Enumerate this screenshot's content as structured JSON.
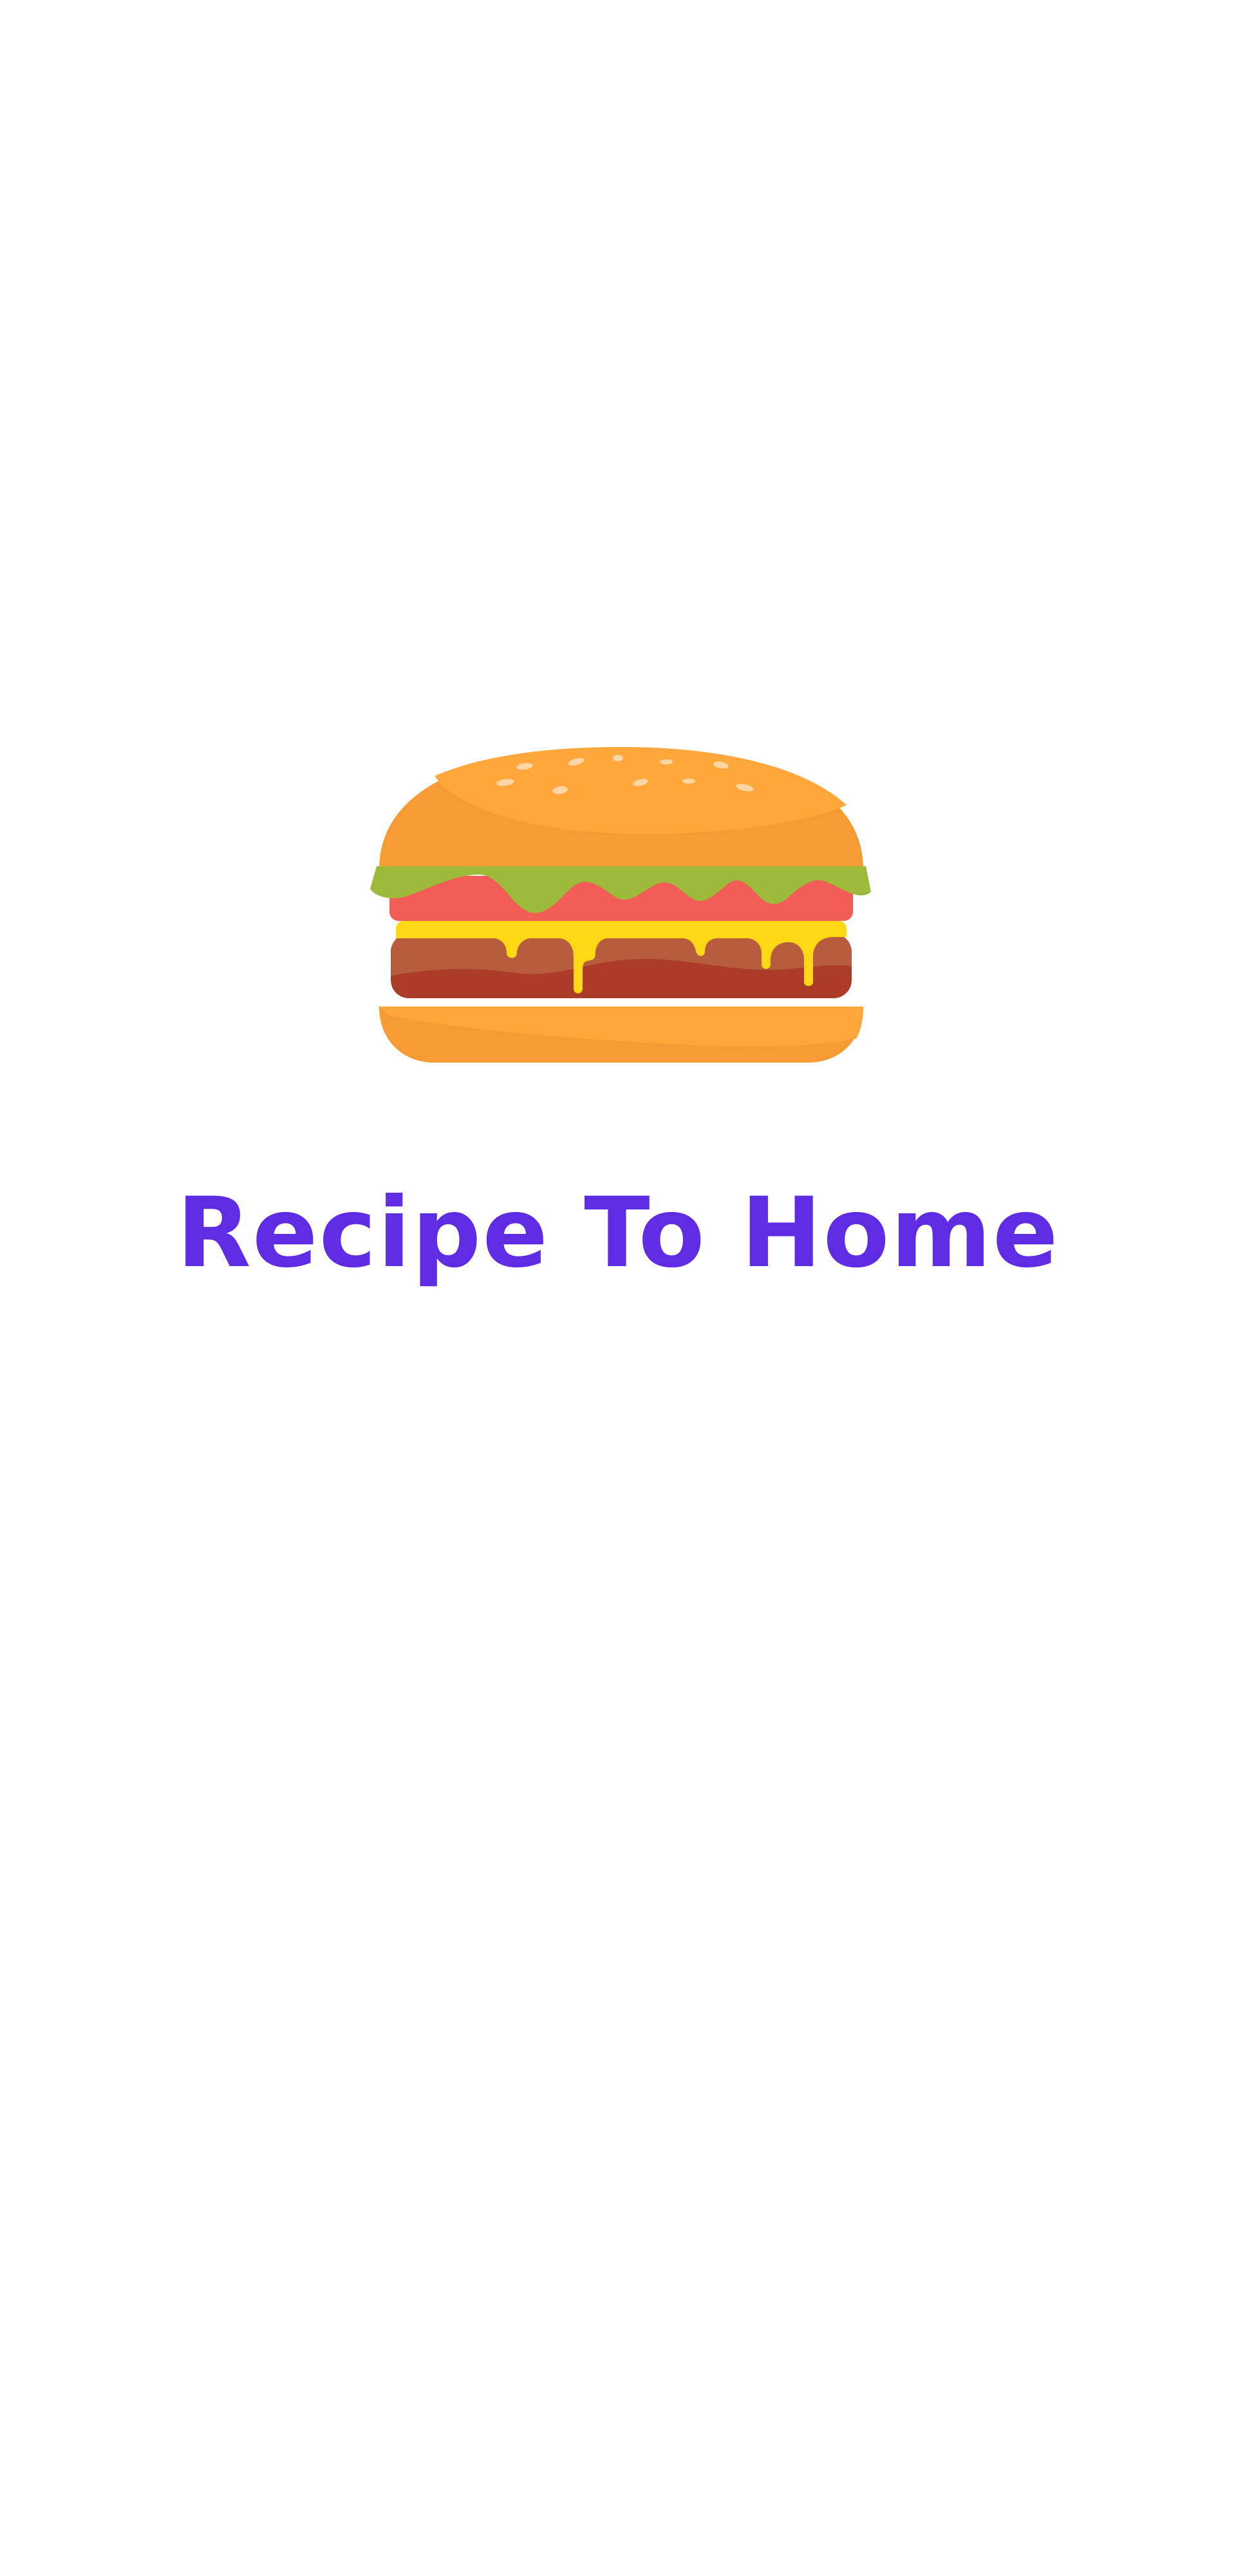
{
  "app": {
    "title": "Recipe To Home",
    "title_color": "#5E2CE3"
  },
  "logo": {
    "icon": "burger-icon",
    "colors": {
      "bun": "#FFA73B",
      "bun_shadow": "#F69A34",
      "lettuce": "#9DBA3B",
      "tomato": "#F25E56",
      "cheese": "#FFD714",
      "patty": "#AB3D28",
      "patty_light": "#B85C3E",
      "sesame": "#FFD6A3"
    }
  }
}
